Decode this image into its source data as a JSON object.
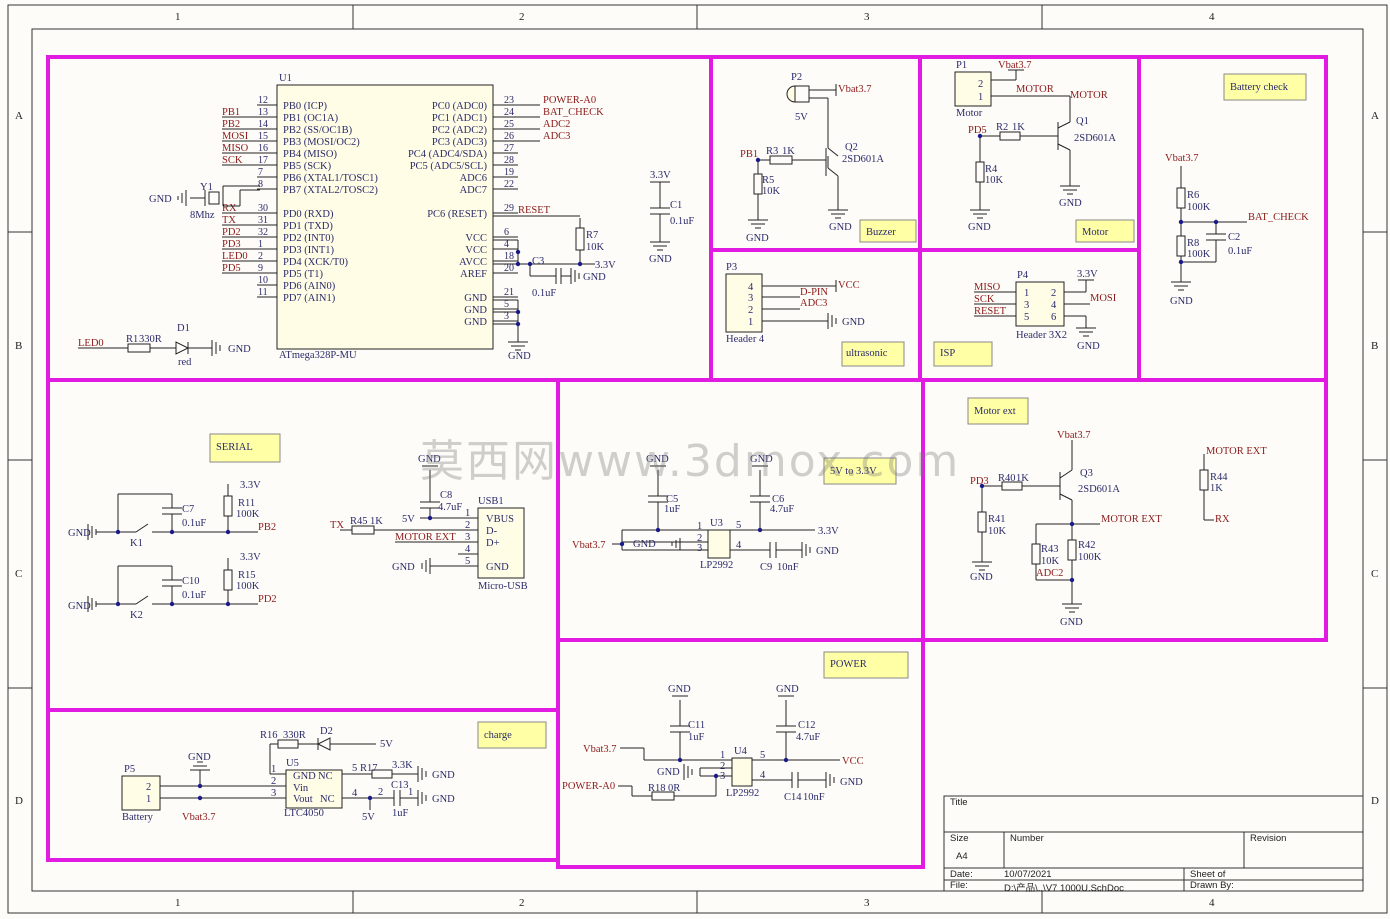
{
  "zones": {
    "cols": [
      "1",
      "2",
      "3",
      "4"
    ],
    "rows": [
      "A",
      "B",
      "C",
      "D"
    ]
  },
  "notes": {
    "buzzer": "Buzzer",
    "motor": "Motor",
    "battery_check": "Battery check",
    "ultrasonic": "ultrasonic",
    "isp": "ISP",
    "motor_ext": "Motor ext",
    "serial": "SERIAL",
    "v5to33": "5V to 3.3V",
    "power": "POWER",
    "charge": "charge"
  },
  "mcu": {
    "ref": "U1",
    "part": "ATmega328P-MU",
    "left_pins": [
      {
        "num": "12",
        "name": "PB0 (ICP)",
        "net": ""
      },
      {
        "num": "13",
        "name": "PB1 (OC1A)",
        "net": "PB1"
      },
      {
        "num": "14",
        "name": "PB2 (SS/OC1B)",
        "net": "PB2"
      },
      {
        "num": "15",
        "name": "PB3 (MOSI/OC2)",
        "net": "MOSI"
      },
      {
        "num": "16",
        "name": "PB4 (MISO)",
        "net": "MISO"
      },
      {
        "num": "17",
        "name": "PB5 (SCK)",
        "net": "SCK"
      },
      {
        "num": "7",
        "name": "PB6 (XTAL1/TOSC1)",
        "net": ""
      },
      {
        "num": "8",
        "name": "PB7 (XTAL2/TOSC2)",
        "net": ""
      },
      {
        "num": "30",
        "name": "PD0 (RXD)",
        "net": "RX"
      },
      {
        "num": "31",
        "name": "PD1 (TXD)",
        "net": "TX"
      },
      {
        "num": "32",
        "name": "PD2 (INT0)",
        "net": "PD2"
      },
      {
        "num": "1",
        "name": "PD3 (INT1)",
        "net": "PD3"
      },
      {
        "num": "2",
        "name": "PD4 (XCK/T0)",
        "net": "LED0"
      },
      {
        "num": "9",
        "name": "PD5 (T1)",
        "net": "PD5"
      },
      {
        "num": "10",
        "name": "PD6 (AIN0)",
        "net": ""
      },
      {
        "num": "11",
        "name": "PD7 (AIN1)",
        "net": ""
      }
    ],
    "right_pins": [
      {
        "num": "23",
        "name": "PC0 (ADC0)",
        "net": "POWER-A0"
      },
      {
        "num": "24",
        "name": "PC1 (ADC1)",
        "net": "BAT_CHECK"
      },
      {
        "num": "25",
        "name": "PC2 (ADC2)",
        "net": "ADC2"
      },
      {
        "num": "26",
        "name": "PC3 (ADC3)",
        "net": "ADC3"
      },
      {
        "num": "27",
        "name": "PC4 (ADC4/SDA)",
        "net": ""
      },
      {
        "num": "28",
        "name": "PC5 (ADC5/SCL)",
        "net": ""
      },
      {
        "num": "19",
        "name": "ADC6",
        "net": ""
      },
      {
        "num": "22",
        "name": "ADC7",
        "net": ""
      },
      {
        "num": "29",
        "name": "PC6 (RESET)",
        "net": "RESET"
      },
      {
        "num": "6",
        "name": "VCC",
        "net": ""
      },
      {
        "num": "4",
        "name": "VCC",
        "net": ""
      },
      {
        "num": "18",
        "name": "AVCC",
        "net": ""
      },
      {
        "num": "20",
        "name": "AREF",
        "net": ""
      },
      {
        "num": "21",
        "name": "GND",
        "net": ""
      },
      {
        "num": "5",
        "name": "GND",
        "net": ""
      },
      {
        "num": "3",
        "name": "GND",
        "net": ""
      }
    ]
  },
  "labels": {
    "gnd": "GND",
    "v33": "3.3V",
    "vcc": "VCC",
    "v5": "5V",
    "vbat": "Vbat3.7",
    "y1": "Y1",
    "y1_val": "8Mhz",
    "c1": "C1",
    "c1_val": "0.1uF",
    "c3": "C3",
    "c3_val": "0.1uF",
    "r7": "R7",
    "r7_val": "10K",
    "r1": "R1",
    "r1_val": "330R",
    "d1": "D1",
    "d1_val": "red",
    "led0": "LED0",
    "p2": "P2",
    "p2_val": "5V",
    "q2": "Q2",
    "q2_val": "2SD601A",
    "r3": "R3",
    "r3_val": "1K",
    "r5": "R5",
    "r5_val": "10K",
    "pb1": "PB1",
    "p1": "P1",
    "p1_val": "Motor",
    "motor": "MOTOR",
    "q1": "Q1",
    "q1_val": "2SD601A",
    "r2": "R2",
    "r2_val": "1K",
    "r4": "R4",
    "r4_val": "10K",
    "pd5": "PD5",
    "r6": "R6",
    "r6_val": "100K",
    "r8": "R8",
    "r8_val": "100K",
    "c2": "C2",
    "c2_val": "0.1uF",
    "bat_check": "BAT_CHECK",
    "p3": "P3",
    "p3_val": "Header 4",
    "d_pin": "D-PIN",
    "adc3": "ADC3",
    "p4": "P4",
    "p4_val": "Header 3X2",
    "miso": "MISO",
    "sck": "SCK",
    "reset": "RESET",
    "mosi": "MOSI",
    "k1": "K1",
    "k2": "K2",
    "c7": "C7",
    "c7_val": "0.1uF",
    "c10": "C10",
    "c10_val": "0.1uF",
    "r11": "R11",
    "r11_val": "100K",
    "r15": "R15",
    "r15_val": "100K",
    "pb2": "PB2",
    "pd2": "PD2",
    "tx": "TX",
    "rx": "RX",
    "r45": "R45",
    "r45_val": "1K",
    "c8": "C8",
    "c8_val": "4.7uF",
    "usb1": "USB1",
    "usb1_val": "Micro-USB",
    "vbus": "VBUS",
    "dm": "D-",
    "dp": "D+",
    "motor_ext": "MOTOR EXT",
    "u3": "U3",
    "u3_val": "LP2992",
    "c5": "C5",
    "c5_val": "1uF",
    "c6": "C6",
    "c6_val": "4.7uF",
    "c9": "C9",
    "c9_val": "10nF",
    "q3": "Q3",
    "q3_val": "2SD601A",
    "r40": "R40",
    "r40_val": "1K",
    "r41": "R41",
    "r41_val": "10K",
    "r42": "R42",
    "r42_val": "100K",
    "r43": "R43",
    "r43_val": "10K",
    "adc2": "ADC2",
    "r44": "R44",
    "r44_val": "1K",
    "pd3": "PD3",
    "u4": "U4",
    "u4_val": "LP2992",
    "c11": "C11",
    "c11_val": "1uF",
    "c12": "C12",
    "c12_val": "4.7uF",
    "c14": "C14",
    "c14_val": "10nF",
    "r18": "R18",
    "r18_val": "0R",
    "power_a0": "POWER-A0",
    "p5": "P5",
    "p5_val": "Battery",
    "r16": "R16",
    "r16_val": "330R",
    "d2": "D2",
    "u5": "U5",
    "u5_val": "LTC4050",
    "r17": "R17",
    "r17_val": "3.3K",
    "c13": "C13",
    "c13_val": "1uF",
    "u5_gnd": "GND",
    "u5_nc": "NC",
    "u5_vin": "Vin",
    "u5_vout": "Vout"
  },
  "watermark": "莫西网www.3dmox.com",
  "title_block": {
    "title_label": "Title",
    "size_label": "Size",
    "size_value": "A4",
    "number_label": "Number",
    "revision_label": "Revision",
    "date_label": "Date:",
    "date_value": "10/07/2021",
    "file_label": "File:",
    "file_value": "D:\\产品\\..\\V7 1000U.SchDoc",
    "sheet_label": "Sheet  of",
    "drawn_label": "Drawn By:"
  }
}
